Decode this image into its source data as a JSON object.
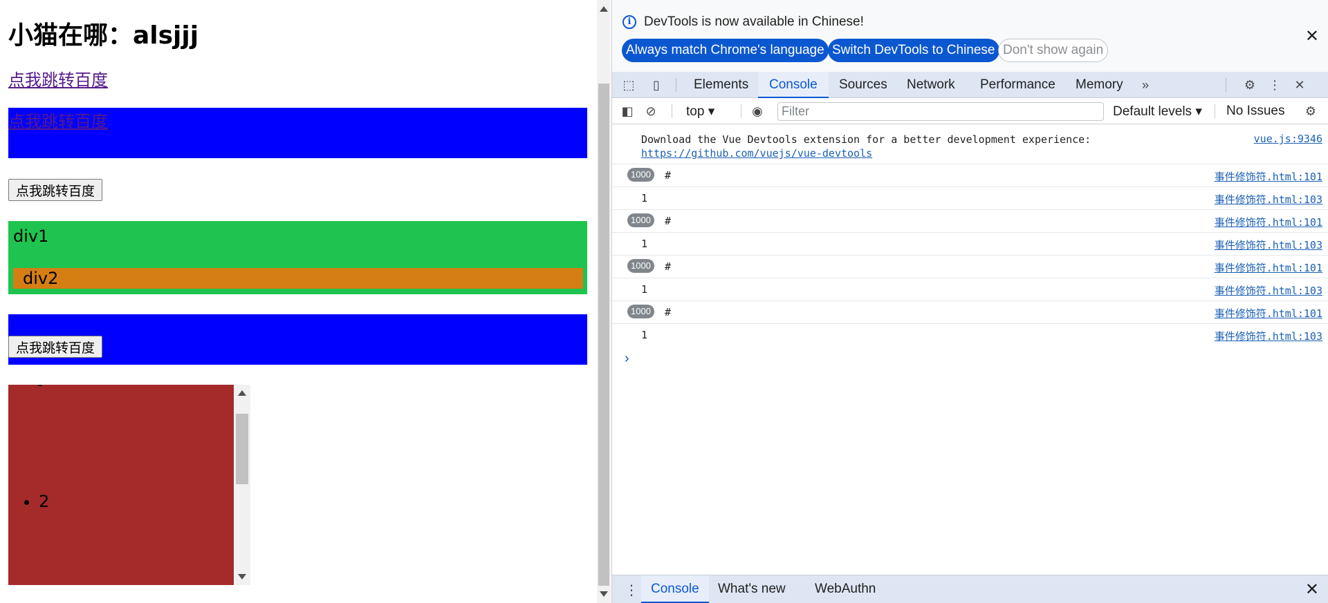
{
  "page": {
    "heading": "小猫在哪：alsjjj",
    "link_label": "点我跳转百度",
    "blue_box_link_label": "点我跳转百度",
    "button1_label": "点我跳转百度",
    "div1_label": "div1",
    "div2_label": "div2",
    "button2_label": "点我跳转百度",
    "list_fragment": "-",
    "list_items": [
      "2"
    ]
  },
  "devtools": {
    "info_message": "DevTools is now available in Chinese!",
    "info_buttons": {
      "always_match": "Always match Chrome's language",
      "switch": "Switch DevTools to Chinese",
      "dont_show": "Don't show again"
    },
    "tabs": [
      "Elements",
      "Console",
      "Sources",
      "Network",
      "Performance",
      "Memory"
    ],
    "active_tab": "Console",
    "toolbar": {
      "context": "top",
      "filter_placeholder": "Filter",
      "levels": "Default levels",
      "issues": "No Issues"
    },
    "console_rows": [
      {
        "type": "vue",
        "text": "Download the Vue Devtools extension for a better development experience:",
        "link": "https://github.com/vuejs/vue-devtools",
        "source": "vue.js:9346"
      },
      {
        "type": "badge",
        "badge": "1000",
        "text": "#",
        "source": "事件修饰符.html:101"
      },
      {
        "type": "value",
        "text": "1",
        "source": "事件修饰符.html:103"
      },
      {
        "type": "badge",
        "badge": "1000",
        "text": "#",
        "source": "事件修饰符.html:101"
      },
      {
        "type": "value",
        "text": "1",
        "source": "事件修饰符.html:103"
      },
      {
        "type": "badge",
        "badge": "1000",
        "text": "#",
        "source": "事件修饰符.html:101"
      },
      {
        "type": "value",
        "text": "1",
        "source": "事件修饰符.html:103"
      },
      {
        "type": "badge",
        "badge": "1000",
        "text": "#",
        "source": "事件修饰符.html:101"
      },
      {
        "type": "value",
        "text": "1",
        "source": "事件修饰符.html:103"
      }
    ],
    "drawer_tabs": [
      "Console",
      "What's new",
      "WebAuthn"
    ],
    "drawer_active": "Console"
  },
  "colors": {
    "blue_box": "#0000ff",
    "div1": "#1ec44f",
    "div2": "#d57e13",
    "scroll_box": "#a52a2a",
    "accent": "#0b57d0"
  }
}
